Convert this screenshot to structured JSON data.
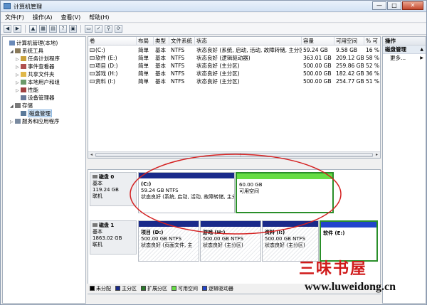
{
  "window": {
    "title": "计算机管理",
    "min_label": "—",
    "max_label": "□",
    "close_label": "✕"
  },
  "menu": [
    "文件(F)",
    "操作(A)",
    "查看(V)",
    "帮助(H)"
  ],
  "tree": [
    {
      "label": "计算机管理(本地)",
      "expander": "",
      "icon": "computer-icon",
      "level": 0
    },
    {
      "label": "系统工具",
      "expander": "◢",
      "icon": "tools-icon",
      "level": 1
    },
    {
      "label": "任务计划程序",
      "expander": "▷",
      "icon": "clock-icon",
      "level": 2
    },
    {
      "label": "事件查看器",
      "expander": "▷",
      "icon": "event-icon",
      "level": 2
    },
    {
      "label": "共享文件夹",
      "expander": "▷",
      "icon": "folder-icon",
      "level": 2
    },
    {
      "label": "本地用户和组",
      "expander": "▷",
      "icon": "users-icon",
      "level": 2
    },
    {
      "label": "性能",
      "expander": "▷",
      "icon": "perf-icon",
      "level": 2
    },
    {
      "label": "设备管理器",
      "expander": "",
      "icon": "device-icon",
      "level": 2
    },
    {
      "label": "存储",
      "expander": "◢",
      "icon": "storage-icon",
      "level": 1
    },
    {
      "label": "磁盘管理",
      "expander": "",
      "icon": "disk-icon",
      "level": 2,
      "selected": true
    },
    {
      "label": "服务和应用程序",
      "expander": "▷",
      "icon": "services-icon",
      "level": 1
    }
  ],
  "list": {
    "columns": [
      "卷",
      "布局",
      "类型",
      "文件系统",
      "状态",
      "容量",
      "可用空间",
      "% 可"
    ],
    "rows": [
      [
        "(C:)",
        "简单",
        "基本",
        "NTFS",
        "状态良好 (系统, 启动, 活动, 故障转储, 主分区)",
        "59.24 GB",
        "9.58 GB",
        "16 %"
      ],
      [
        "软件 (E:)",
        "简单",
        "基本",
        "NTFS",
        "状态良好 (逻辑驱动器)",
        "363.01 GB",
        "209.12 GB",
        "58 %"
      ],
      [
        "项目 (D:)",
        "简单",
        "基本",
        "NTFS",
        "状态良好 (主分区)",
        "500.00 GB",
        "259.86 GB",
        "52 %"
      ],
      [
        "游戏 (H:)",
        "简单",
        "基本",
        "NTFS",
        "状态良好 (主分区)",
        "500.00 GB",
        "182.42 GB",
        "36 %"
      ],
      [
        "资料 (I:)",
        "简单",
        "基本",
        "NTFS",
        "状态良好 (主分区)",
        "500.00 GB",
        "254.77 GB",
        "51 %"
      ]
    ]
  },
  "disks": [
    {
      "name": "磁盘 0",
      "type": "基本",
      "size": "119.24 GB",
      "status": "联机",
      "partitions": [
        {
          "name": "(C:)",
          "size": "59.24 GB NTFS",
          "status": "状态良好 (系统, 启动, 活动, 故障转储, 主分区)",
          "kind": "primary"
        },
        {
          "name": "",
          "size": "60.00 GB",
          "status": "可用空间",
          "kind": "free"
        }
      ]
    },
    {
      "name": "磁盘 1",
      "type": "基本",
      "size": "1863.02 GB",
      "status": "联机",
      "partitions": [
        {
          "name": "项目 (D:)",
          "size": "500.00 GB NTFS",
          "status": "状态良好 (页面文件, 主",
          "kind": "primary"
        },
        {
          "name": "游戏 (H:)",
          "size": "500.00 GB NTFS",
          "status": "状态良好 (主分区)",
          "kind": "primary"
        },
        {
          "name": "资料 (I:)",
          "size": "500.00 GB NTFS",
          "status": "状态良好 (主分区)",
          "kind": "primary"
        },
        {
          "name": "软件 (E:)",
          "size": "",
          "status": "",
          "kind": "logical"
        }
      ]
    }
  ],
  "legend": [
    {
      "label": "未分配",
      "color": "#000000"
    },
    {
      "label": "主分区",
      "color": "#1a2a8a"
    },
    {
      "label": "扩展分区",
      "color": "#2a7a2a"
    },
    {
      "label": "可用空间",
      "color": "#66dd44"
    },
    {
      "label": "逻辑驱动器",
      "color": "#2244cc"
    }
  ],
  "actions": {
    "header": "操作",
    "section": "磁盘管理",
    "more": "更多..."
  },
  "colors": {
    "primary_bar": "#1a2a8a",
    "free_bar": "#66dd44",
    "logical_bar": "#2244cc",
    "annotation": "#d42020"
  },
  "watermark": {
    "text": "三味书屋",
    "url": "www.luweidong.cn"
  }
}
